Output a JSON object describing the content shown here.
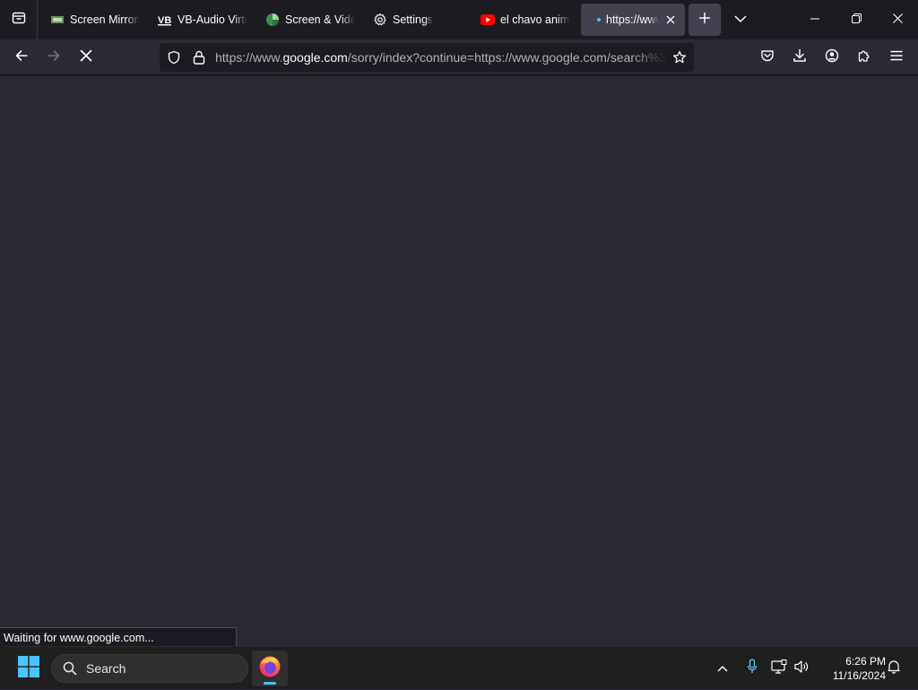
{
  "tabs": [
    {
      "title": "Screen Mirroring",
      "icon": "screen-mirroring-favicon"
    },
    {
      "title": "VB-Audio Virtual",
      "icon": "vb-audio-favicon"
    },
    {
      "title": "Screen & Video",
      "icon": "screen-video-favicon"
    },
    {
      "title": "Settings",
      "icon": "gear-icon"
    },
    {
      "title": "el chavo animado",
      "icon": "youtube-icon"
    },
    {
      "title": "https://www.google.com",
      "icon": "loading-dot-icon",
      "active": true
    }
  ],
  "nav": {
    "url_prefix": "https://www.",
    "url_host": "google.com",
    "url_rest": "/sorry/index?continue=https://www.google.com/search%3"
  },
  "status": {
    "text": "Waiting for www.google.com..."
  },
  "taskbar": {
    "search_placeholder": "Search",
    "time": "6:26 PM",
    "date": "11/16/2024"
  },
  "colors": {
    "accent": "#4cc2ff",
    "chrome_bg": "#1c1b22",
    "content_bg": "#2b2a33",
    "youtube_red": "#ff0000"
  }
}
